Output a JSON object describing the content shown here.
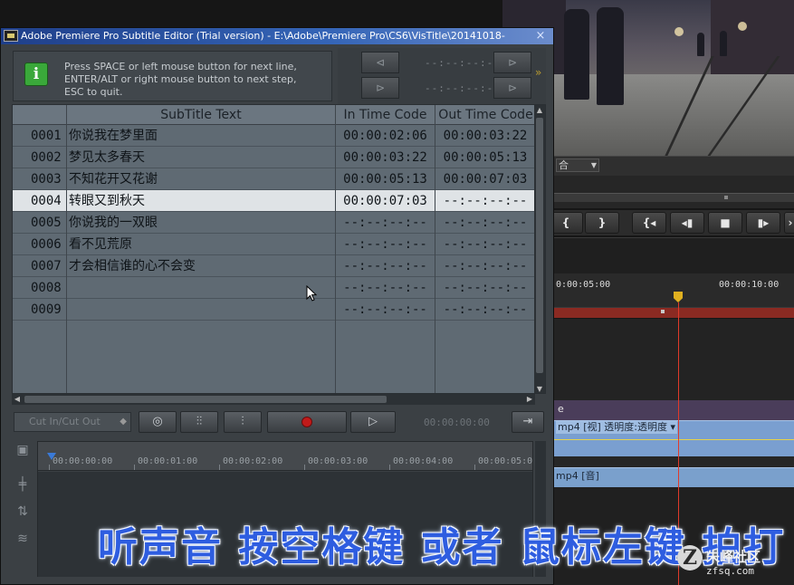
{
  "window": {
    "title": "Adobe Premiere Pro Subtitle Editor (Trial version) - E:\\Adobe\\Premiere Pro\\CS6\\VisTitle\\20141018-",
    "close_label": "×"
  },
  "hint": {
    "icon_label": "i",
    "lines": [
      "Press SPACE or left mouse button for next line,",
      "ENTER/ALT or right mouse button to next step,",
      "ESC to quit."
    ]
  },
  "nav": {
    "dash_top": "--:--:--:--",
    "dash_bottom": "--:--:--:--"
  },
  "table": {
    "headers": {
      "text": "SubTitle Text",
      "in": "In Time Code",
      "out": "Out Time Code"
    },
    "rows": [
      {
        "num": "0001",
        "text": "你说我在梦里面",
        "in": "00:00:02:06",
        "out": "00:00:03:22"
      },
      {
        "num": "0002",
        "text": "梦见太多春天",
        "in": "00:00:03:22",
        "out": "00:00:05:13"
      },
      {
        "num": "0003",
        "text": "不知花开又花谢",
        "in": "00:00:05:13",
        "out": "00:00:07:03"
      },
      {
        "num": "0004",
        "text": "转眼又到秋天",
        "in": "00:00:07:03",
        "out": "--:--:--:--"
      },
      {
        "num": "0005",
        "text": "你说我的一双眼",
        "in": "--:--:--:--",
        "out": "--:--:--:--"
      },
      {
        "num": "0006",
        "text": "看不见荒原",
        "in": "--:--:--:--",
        "out": "--:--:--:--"
      },
      {
        "num": "0007",
        "text": "才会相信谁的心不会变",
        "in": "--:--:--:--",
        "out": "--:--:--:--"
      },
      {
        "num": "0008",
        "text": "",
        "in": "--:--:--:--",
        "out": "--:--:--:--"
      },
      {
        "num": "0009",
        "text": "",
        "in": "--:--:--:--",
        "out": "--:--:--:--"
      }
    ],
    "selected_index": 3
  },
  "record_bar": {
    "mode": "Cut In/Cut Out",
    "timecode": "00:00:00:00"
  },
  "lower_timeline": {
    "marks": [
      "00:00:00:00",
      "00:00:01:00",
      "00:00:02:00",
      "00:00:03:00",
      "00:00:04:00",
      "00:00:05:0"
    ]
  },
  "premiere": {
    "blend_mode": "合",
    "timecodes": [
      "0:00:05:00",
      "00:00:10:00"
    ],
    "sequence_label": "e",
    "video_clip": "mp4 [视] 透明度:透明度 ▾",
    "audio_clip": "mp4 [音]"
  },
  "caption": "听声音 按空格键 或者 鼠标左键 拍打",
  "watermark": {
    "badge": "Z",
    "name": "朱峰社区",
    "url": "zfsq.com"
  },
  "colors": {
    "titlebar": "#1f3f8a",
    "record": "#c11a1a",
    "caption": "#2e5de0",
    "playhead": "#e03a2a",
    "selected_row": "#dfe3e6"
  }
}
